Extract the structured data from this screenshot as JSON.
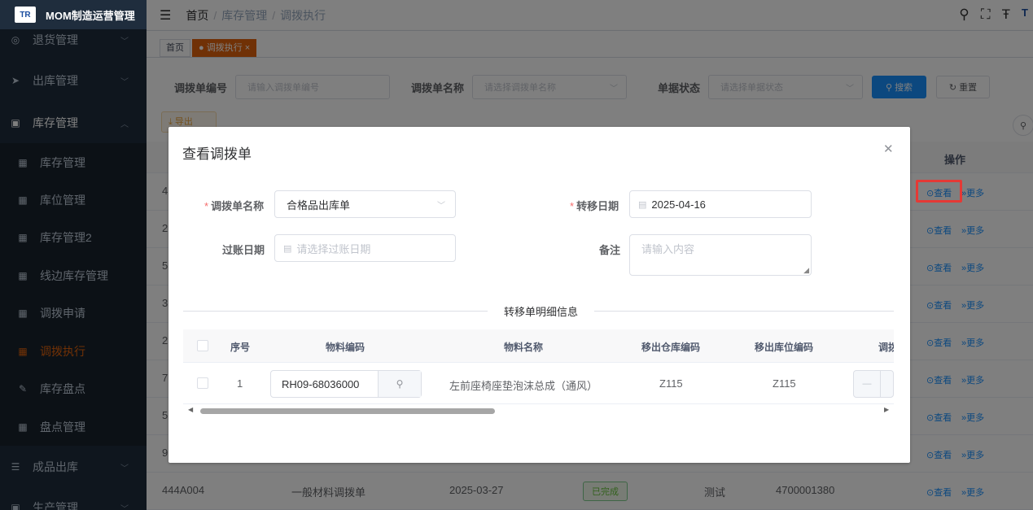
{
  "app": {
    "logo_mark": "TR",
    "title": "MOM制造运营管理"
  },
  "sidebar": {
    "items": [
      {
        "label": "退货管理",
        "icon": "return-icon"
      },
      {
        "label": "出库管理",
        "icon": "send-icon"
      },
      {
        "label": "库存管理",
        "icon": "inventory-icon"
      },
      {
        "label": "成品出库",
        "icon": "list-icon"
      },
      {
        "label": "生产管理",
        "icon": "production-icon"
      }
    ],
    "subitems": [
      {
        "label": "库存管理"
      },
      {
        "label": "库位管理"
      },
      {
        "label": "库存管理2"
      },
      {
        "label": "线边库存管理"
      },
      {
        "label": "调拨申请"
      },
      {
        "label": "调拨执行"
      },
      {
        "label": "库存盘点"
      },
      {
        "label": "盘点管理"
      }
    ]
  },
  "header": {
    "breadcrumb": [
      "首页",
      "库存管理",
      "调拨执行"
    ]
  },
  "tags": {
    "home": "首页",
    "active": "调拨执行"
  },
  "filters": {
    "code_label": "调拨单编号",
    "code_placeholder": "请输入调拨单编号",
    "name_label": "调拨单名称",
    "name_placeholder": "请选择调拨单名称",
    "status_label": "单据状态",
    "status_placeholder": "请选择单据状态",
    "search_btn": "搜索",
    "reset_btn": "重置",
    "export_btn": "导出"
  },
  "table": {
    "op_header": "操作",
    "view_label": "查看",
    "more_label": "更多",
    "row_prefixes": [
      "4",
      "2",
      "5",
      "3",
      "2",
      "7",
      "5",
      "9"
    ],
    "last_row": {
      "code": "444A004",
      "name": "一般材料调拨单",
      "date": "2025-03-27",
      "status": "已完成",
      "remark": "测试",
      "number": "4700001380"
    }
  },
  "dialog": {
    "title": "查看调拨单",
    "name_label": "调拨单名称",
    "name_value": "合格品出库单",
    "transfer_date_label": "转移日期",
    "transfer_date_value": "2025-04-16",
    "posting_date_label": "过账日期",
    "posting_date_placeholder": "请选择过账日期",
    "remark_label": "备注",
    "remark_placeholder": "请输入内容",
    "section_title": "转移单明细信息",
    "columns": [
      "序号",
      "物料编码",
      "物料名称",
      "移出仓库编码",
      "移出库位编码",
      "调拨"
    ],
    "rows": [
      {
        "index": "1",
        "material_code": "RH09-68036000",
        "material_name": "左前座椅座垫泡沫总成（通风）",
        "out_warehouse": "Z115",
        "out_location": "Z115"
      }
    ]
  }
}
